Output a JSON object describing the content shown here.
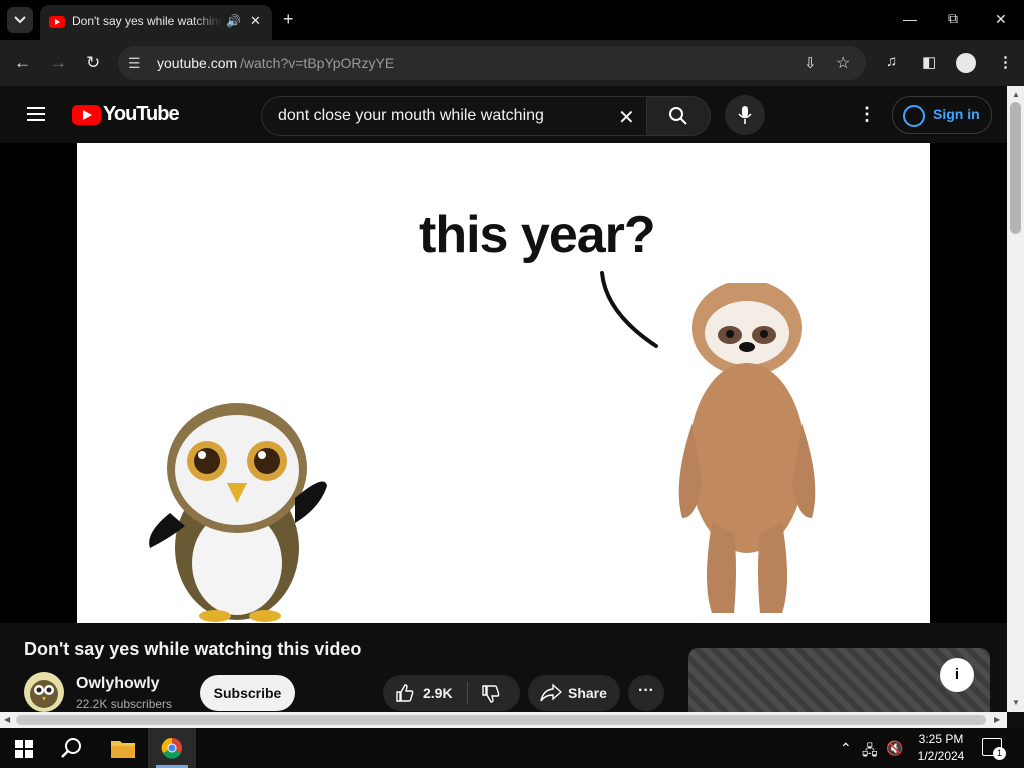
{
  "browser": {
    "tab_title": "Don't say yes while watching",
    "url_host": "youtube.com",
    "url_path": "/watch?v=tBpYpORzyYE"
  },
  "youtube": {
    "logo_text": "YouTube",
    "search_query": "dont close your mouth while watching",
    "sign_in_label": "Sign in"
  },
  "video": {
    "frame_caption": "this year?",
    "title": "Don't say yes while watching this video",
    "channel_name": "Owlyhowly",
    "subscribers": "22.2K subscribers",
    "subscribe_label": "Subscribe",
    "likes": "2.9K",
    "share_label": "Share"
  },
  "taskbar": {
    "time": "3:25 PM",
    "date": "1/2/2024",
    "notification_count": "1"
  },
  "colors": {
    "youtube_red": "#ff0000",
    "link_blue": "#3ea6ff"
  }
}
